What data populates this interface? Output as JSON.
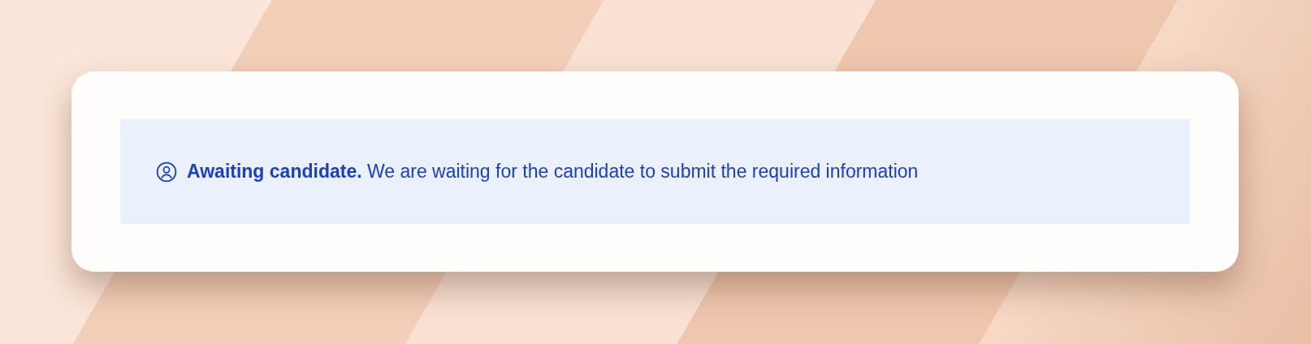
{
  "status_banner": {
    "kind": "awaiting",
    "message": "**Awaiting candidate.** We are waiting for the candidate to submit the required information"
  }
}
